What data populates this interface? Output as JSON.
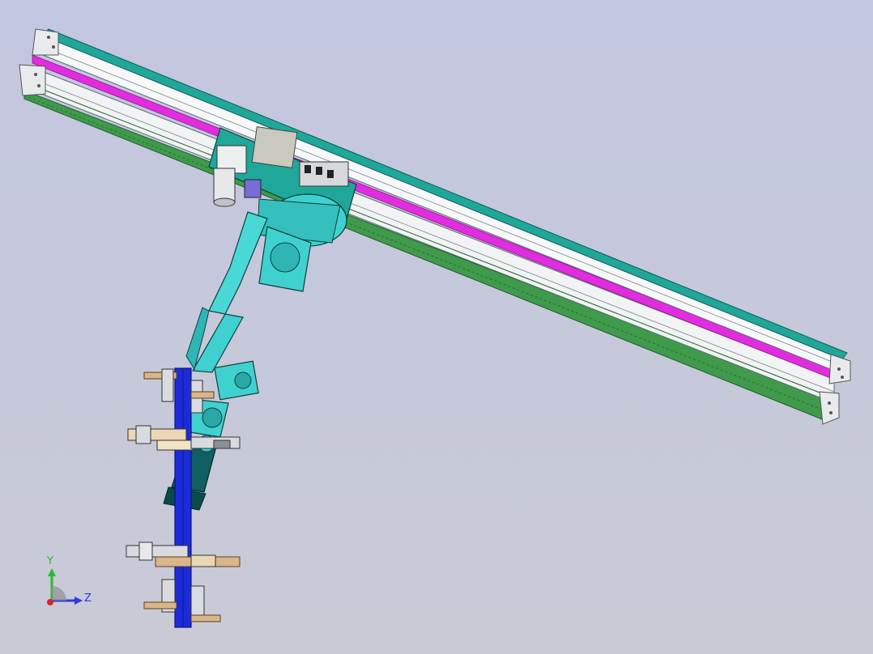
{
  "triad": {
    "y_label": "Y",
    "z_label": "Z",
    "y_color": "#2fb82f",
    "z_color": "#2a3bd8",
    "origin_color": "#d9262a"
  },
  "colors": {
    "background": "#c4c7dd",
    "rail_teal": "#1fa79a",
    "rail_white": "#f4f6f7",
    "rail_magenta": "#e22ce0",
    "rail_green": "#3f9a4c",
    "robot_cyan": "#3fd1cf",
    "robot_dark": "#0f5f63",
    "fixture_blue": "#1c2bd8",
    "gripper_tan": "#d8b68a",
    "gripper_gray": "#d9dbe0"
  }
}
